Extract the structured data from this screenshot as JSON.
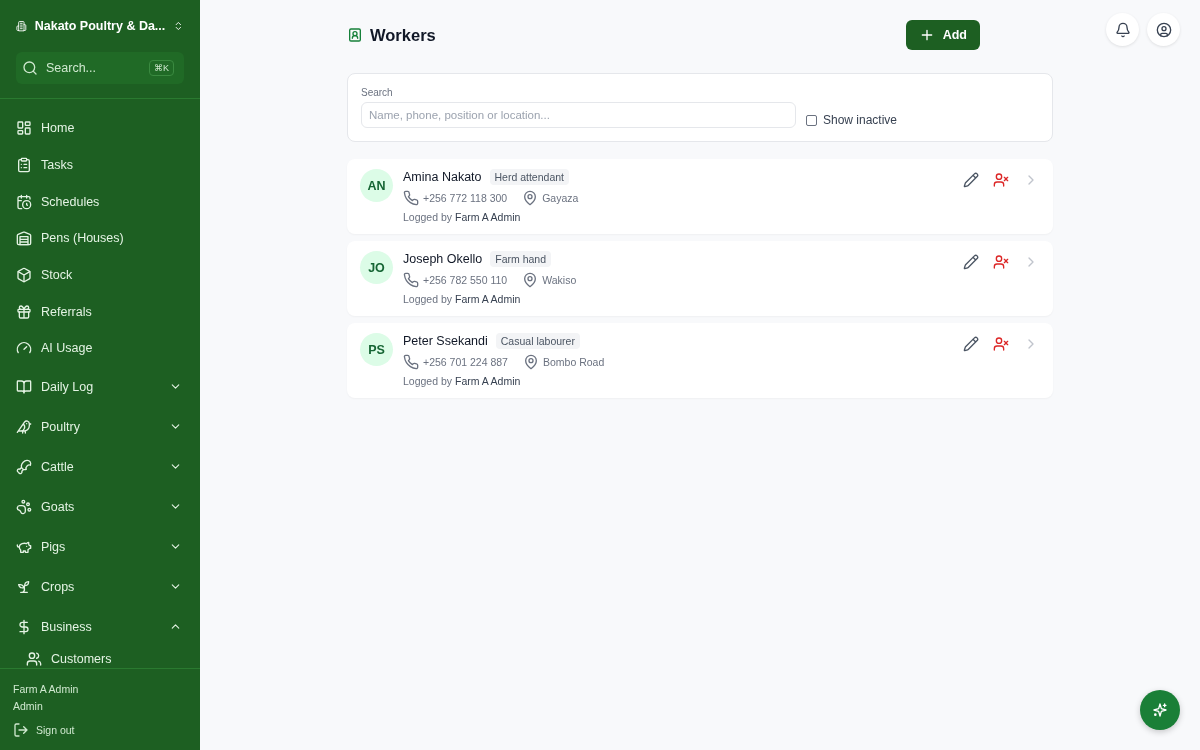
{
  "sidebar": {
    "farm_name": "Nakato Poultry & Da...",
    "search": {
      "placeholder": "Search...",
      "shortcut": "⌘K"
    },
    "items": [
      {
        "label": "Home",
        "kind": "link"
      },
      {
        "label": "Tasks",
        "kind": "link"
      },
      {
        "label": "Schedules",
        "kind": "link"
      },
      {
        "label": "Pens (Houses)",
        "kind": "link"
      },
      {
        "label": "Stock",
        "kind": "link"
      },
      {
        "label": "Referrals",
        "kind": "link"
      },
      {
        "label": "AI Usage",
        "kind": "link"
      },
      {
        "label": "Daily Log",
        "kind": "group",
        "expanded": false
      },
      {
        "label": "Poultry",
        "kind": "group",
        "expanded": false
      },
      {
        "label": "Cattle",
        "kind": "group",
        "expanded": false
      },
      {
        "label": "Goats",
        "kind": "group",
        "expanded": false
      },
      {
        "label": "Pigs",
        "kind": "group",
        "expanded": false
      },
      {
        "label": "Crops",
        "kind": "group",
        "expanded": false
      },
      {
        "label": "Business",
        "kind": "group",
        "expanded": true,
        "children": [
          {
            "label": "Customers"
          }
        ]
      }
    ],
    "user": {
      "name": "Farm A Admin",
      "role": "Admin"
    },
    "sign_out": "Sign out"
  },
  "page": {
    "title": "Workers",
    "add_button": "Add"
  },
  "filters": {
    "search_label": "Search",
    "search_placeholder": "Name, phone, position or location...",
    "show_inactive": {
      "label": "Show inactive",
      "checked": false
    }
  },
  "workers": [
    {
      "initials": "AN",
      "name": "Amina Nakato",
      "position": "Herd attendant",
      "phone": "+256 772 118 300",
      "location": "Gayaza",
      "logged_by_prefix": "Logged by",
      "logged_by": "Farm A Admin"
    },
    {
      "initials": "JO",
      "name": "Joseph Okello",
      "position": "Farm hand",
      "phone": "+256 782 550 110",
      "location": "Wakiso",
      "logged_by_prefix": "Logged by",
      "logged_by": "Farm A Admin"
    },
    {
      "initials": "PS",
      "name": "Peter Ssekandi",
      "position": "Casual labourer",
      "phone": "+256 701 224 887",
      "location": "Bombo Road",
      "logged_by_prefix": "Logged by",
      "logged_by": "Farm A Admin"
    }
  ]
}
